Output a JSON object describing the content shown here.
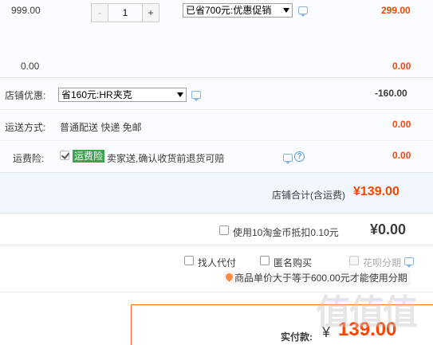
{
  "item": {
    "unit_price": "999.00",
    "qty_minus": "-",
    "qty_value": "1",
    "qty_plus": "+",
    "promo_select": "已省700元:优惠促销",
    "subtotal": "299.00",
    "extra_value": "0.00",
    "extra_total": "0.00"
  },
  "shop_discount": {
    "label": "店铺优惠:",
    "select": "省160元:HR夹克",
    "amount": "-160.00"
  },
  "shipping": {
    "label": "运送方式:",
    "text": "普通配送 快递 免邮",
    "amount": "0.00"
  },
  "insurance": {
    "label": "运费险:",
    "badge": "运费险",
    "text": "卖家送,确认收货前退货可赔",
    "help_icon": "?",
    "amount": "0.00"
  },
  "shop_total": {
    "label": "店铺合计(含运费)",
    "amount": "¥139.00"
  },
  "coins": {
    "label": "使用10淘金币抵扣0.10元",
    "amount": "¥0.00"
  },
  "options": {
    "proxy_pay": "找人代付",
    "anonymous": "匿名购买",
    "huabei": "花呗分期",
    "huabei_note": "商品单价大于等于600.00元才能使用分期"
  },
  "payment": {
    "label": "实付款:",
    "currency": "¥",
    "amount": "139.00"
  },
  "watermark": "值值值",
  "colors": {
    "price_red": "#ff4400",
    "row_bg": "#fbfcff",
    "shop_bg": "#f2f7ff",
    "border": "#e6e6e6",
    "badge_green": "#3aa54c",
    "orange_box": "#ff6a2a"
  }
}
